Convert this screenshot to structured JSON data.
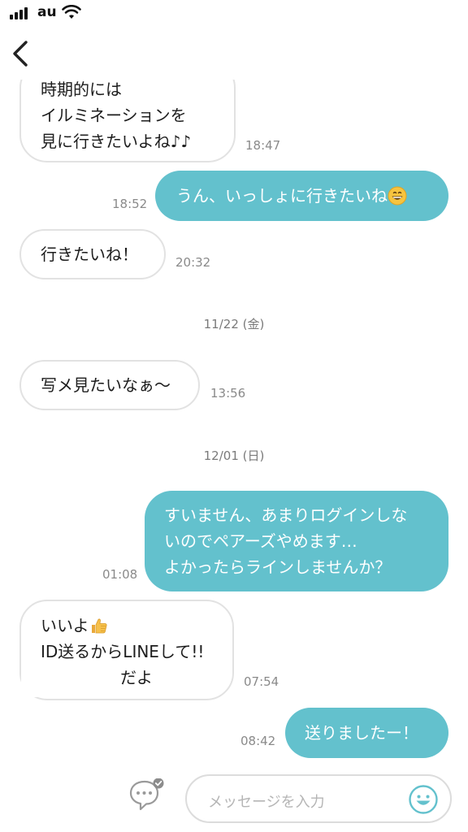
{
  "status": {
    "carrier": "au"
  },
  "messages": [
    {
      "lines": [
        "時期的には",
        "イルミネーションを",
        "見に行きたいよね♪♪"
      ],
      "time": "18:47"
    },
    {
      "lines": [
        "うん、いっしょに行きたいね"
      ],
      "time": "18:52",
      "emoji": "grinning-face-icon"
    },
    {
      "lines": [
        "行きたいね！"
      ],
      "time": "20:32"
    },
    {
      "lines": [
        "写メ見たいなぁ〜"
      ],
      "time": "13:56"
    },
    {
      "lines": [
        "すいません、あまりログインしな",
        "いのでペアーズやめます…",
        "よかったらラインしませんか？"
      ],
      "time": "01:08"
    },
    {
      "lines": [
        "いいよ",
        "ID送るからLINEして!!",
        "だよ"
      ],
      "time": "07:54",
      "emoji": "thumbs-up-icon"
    },
    {
      "lines": [
        "送りましたー！"
      ],
      "time": "08:42"
    }
  ],
  "dates": [
    "11/22 (金)",
    "12/01 (日)"
  ],
  "input": {
    "placeholder": "メッセージを入力"
  },
  "colors": {
    "outgoing": "#63c1cd",
    "incoming_border": "#e2e2e2",
    "background": "#ffffff"
  }
}
